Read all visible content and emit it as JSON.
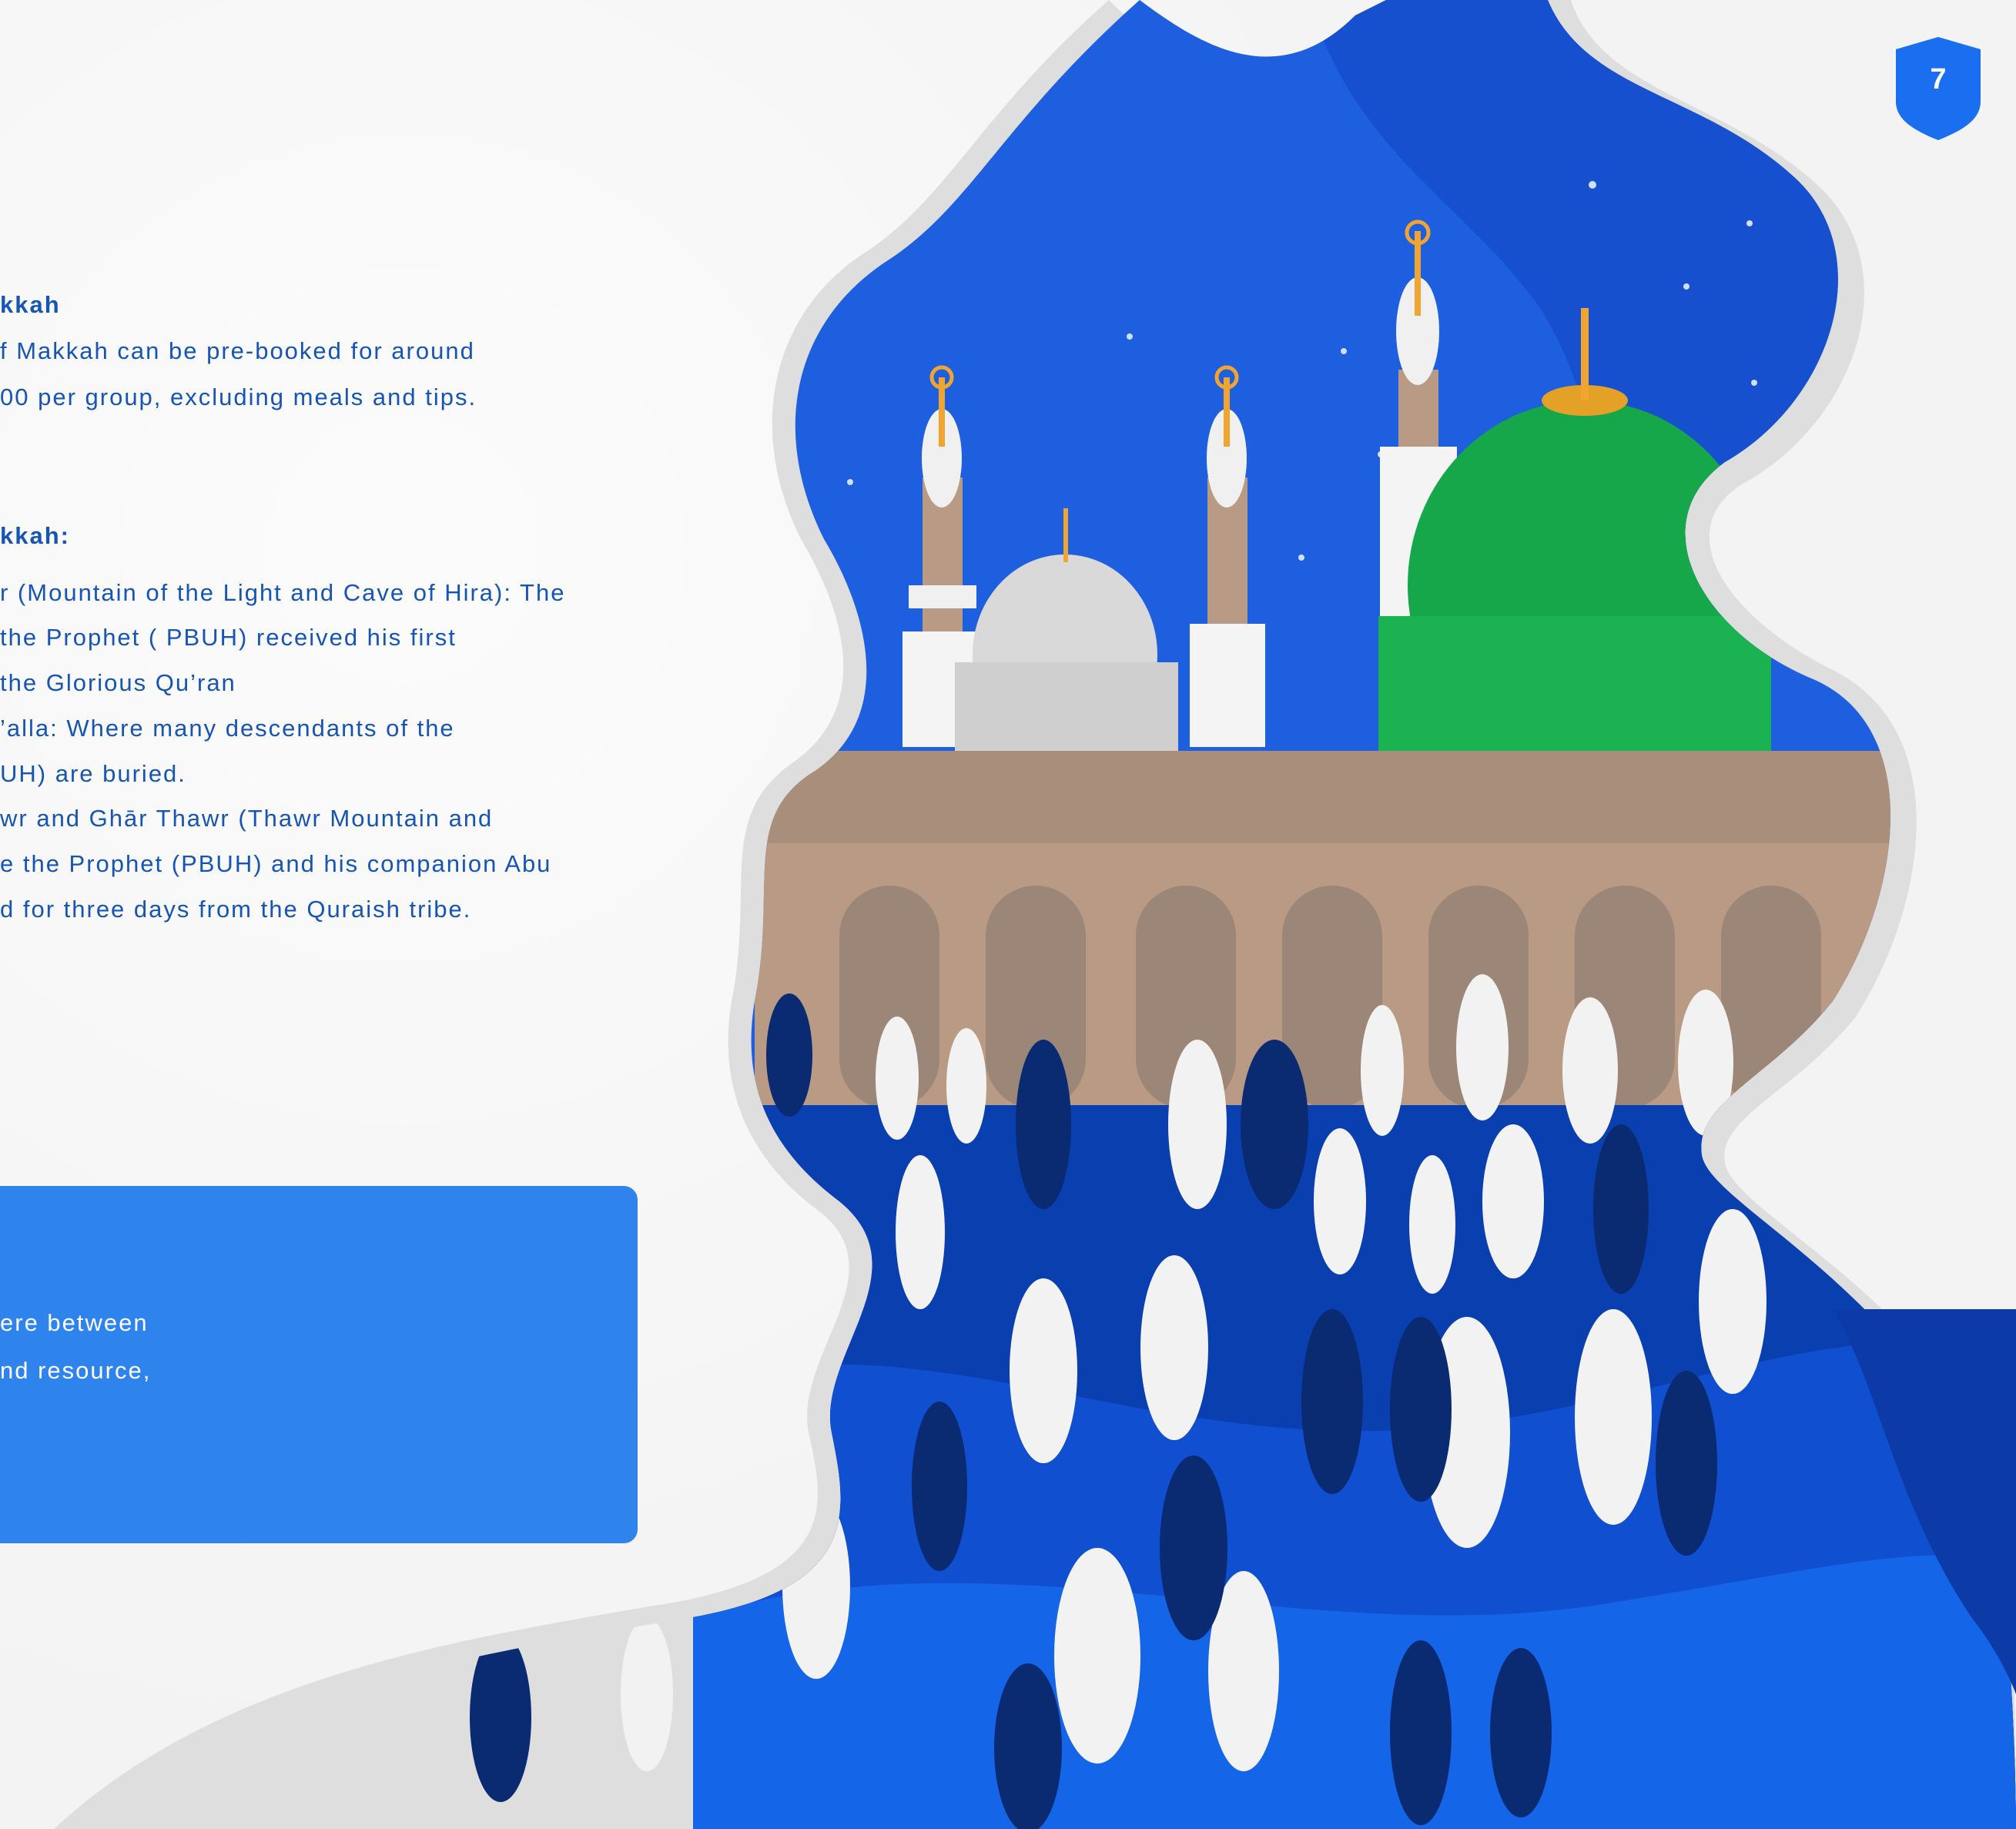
{
  "page": {
    "number": "7"
  },
  "tours": {
    "heading": "kkah",
    "lines": [
      "f Makkah can be pre-booked for around",
      "00 per group, excluding meals and tips."
    ]
  },
  "places": {
    "heading": "kkah:",
    "lines": [
      "r (Mountain of the Light and Cave of Hira):   The",
      "the Prophet ( PBUH) received his first",
      "the Glorious Qu’ran",
      "’alla: Where many descendants of the",
      "UH) are buried.",
      "wr and Ghār Thawr (Thawr Mountain and",
      "e the Prophet (PBUH) and his companion     Abu",
      "d for three days from the Quraish tribe."
    ]
  },
  "callout": {
    "lines": [
      "ere between",
      "nd resource,"
    ]
  },
  "colors": {
    "text_blue": "#1655b3",
    "badge_blue": "#1a6ff0",
    "callout_blue": "#2f83ec",
    "dome_green": "#15a74a",
    "sky_blue": "#1e5fe0",
    "ground_blue": "#0a3fb0",
    "wall_tan": "#b99a84"
  },
  "icons": {
    "page_badge": "shield-icon",
    "illustration": "mosque-illustration"
  }
}
